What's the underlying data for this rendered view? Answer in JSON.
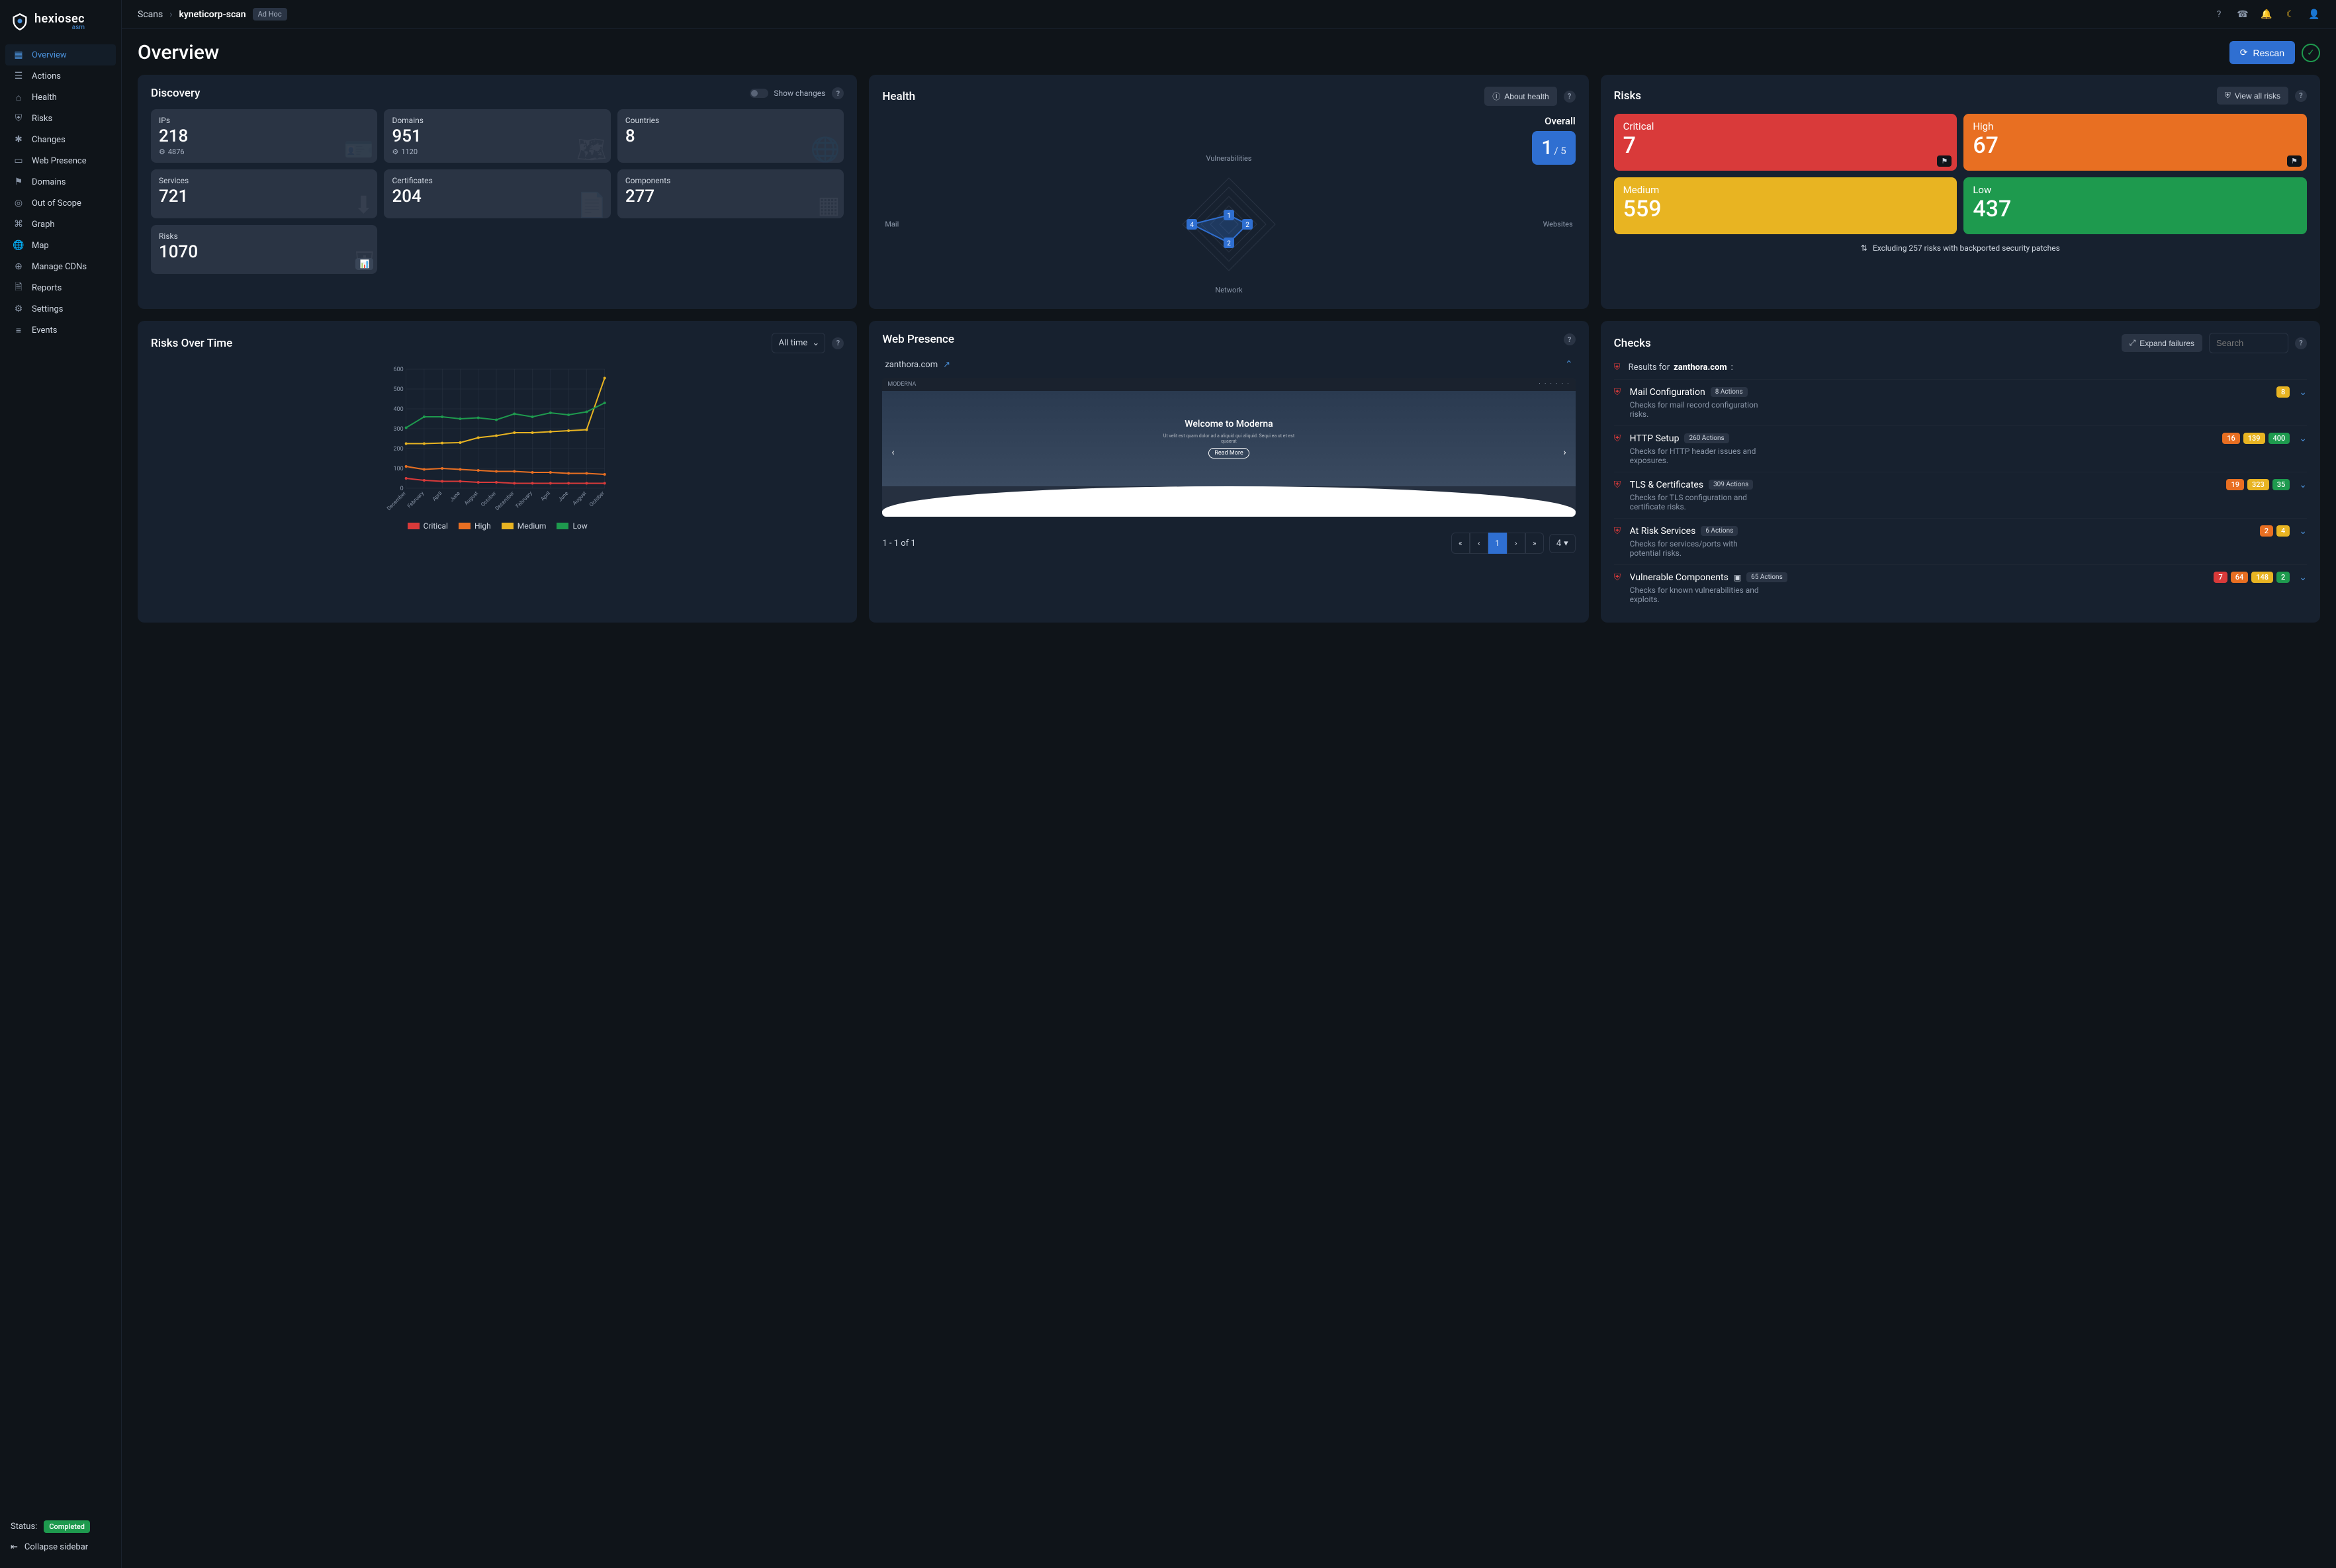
{
  "brand": {
    "name": "hexiosec",
    "sub": "asm"
  },
  "breadcrumb": {
    "root": "Scans",
    "name": "kyneticorp-scan",
    "tag": "Ad Hoc"
  },
  "topbar_icons": [
    "help",
    "support",
    "bell",
    "moon",
    "user"
  ],
  "nav": [
    {
      "icon": "grid",
      "label": "Overview",
      "active": true
    },
    {
      "icon": "list",
      "label": "Actions"
    },
    {
      "icon": "home",
      "label": "Health"
    },
    {
      "icon": "shield",
      "label": "Risks"
    },
    {
      "icon": "star",
      "label": "Changes"
    },
    {
      "icon": "monitor",
      "label": "Web Presence"
    },
    {
      "icon": "sitemap",
      "label": "Domains"
    },
    {
      "icon": "target",
      "label": "Out of Scope"
    },
    {
      "icon": "graph",
      "label": "Graph"
    },
    {
      "icon": "globe",
      "label": "Map"
    },
    {
      "icon": "cdn",
      "label": "Manage CDNs"
    },
    {
      "icon": "file",
      "label": "Reports"
    },
    {
      "icon": "gear",
      "label": "Settings"
    },
    {
      "icon": "lines",
      "label": "Events"
    }
  ],
  "status": {
    "label": "Status:",
    "value": "Completed"
  },
  "collapse": "Collapse sidebar",
  "page_title": "Overview",
  "rescan": "Rescan",
  "discovery": {
    "title": "Discovery",
    "show_changes": "Show changes",
    "tiles": [
      {
        "label": "IPs",
        "value": "218",
        "sub": "4876"
      },
      {
        "label": "Domains",
        "value": "951",
        "sub": "1120"
      },
      {
        "label": "Countries",
        "value": "8"
      },
      {
        "label": "Services",
        "value": "721"
      },
      {
        "label": "Certificates",
        "value": "204"
      },
      {
        "label": "Components",
        "value": "277"
      },
      {
        "label": "Risks",
        "value": "1070"
      }
    ]
  },
  "health": {
    "title": "Health",
    "about": "About health",
    "overall_label": "Overall",
    "overall_score": "1",
    "overall_max": "/ 5",
    "axes": [
      "Vulnerabilities",
      "Websites",
      "Network",
      "Mail"
    ],
    "points": [
      1,
      2,
      2,
      4
    ]
  },
  "risks": {
    "title": "Risks",
    "view_all": "View all risks",
    "tiles": [
      {
        "label": "Critical",
        "value": "7",
        "class": "crit",
        "tag": true
      },
      {
        "label": "High",
        "value": "67",
        "class": "high",
        "tag": true
      },
      {
        "label": "Medium",
        "value": "559",
        "class": "med"
      },
      {
        "label": "Low",
        "value": "437",
        "class": "low"
      }
    ],
    "exclude": "Excluding 257 risks with backported security patches"
  },
  "risks_over_time": {
    "title": "Risks Over Time",
    "range": "All time",
    "legend": [
      "Critical",
      "High",
      "Medium",
      "Low"
    ]
  },
  "chart_data": {
    "type": "line",
    "xlabel": "",
    "ylabel": "",
    "ylim": [
      0,
      600
    ],
    "categories": [
      "December",
      "February",
      "April",
      "June",
      "August",
      "October",
      "December",
      "February",
      "April",
      "June",
      "August",
      "October"
    ],
    "series": [
      {
        "name": "Critical",
        "color": "#d93a3a",
        "values": [
          50,
          40,
          35,
          35,
          30,
          30,
          25,
          25,
          25,
          25,
          25,
          25
        ]
      },
      {
        "name": "High",
        "color": "#e86f22",
        "values": [
          110,
          95,
          100,
          95,
          90,
          85,
          85,
          80,
          80,
          75,
          75,
          70
        ]
      },
      {
        "name": "Medium",
        "color": "#e8b422",
        "values": [
          225,
          225,
          228,
          230,
          255,
          265,
          280,
          280,
          285,
          290,
          295,
          555
        ]
      },
      {
        "name": "Low",
        "color": "#1e9a4e",
        "values": [
          305,
          360,
          360,
          350,
          355,
          345,
          375,
          360,
          380,
          370,
          385,
          430
        ]
      }
    ]
  },
  "web_presence": {
    "title": "Web Presence",
    "domain": "zanthora.com",
    "hero": "Welcome to Moderna",
    "hero_btn": "Read More",
    "brand": "MODERNA",
    "page_range": "1 - 1 of 1",
    "page_num": "1",
    "per_page": "4"
  },
  "checks": {
    "title": "Checks",
    "expand": "Expand failures",
    "search_placeholder": "Search",
    "results_for": "Results for",
    "domain": "zanthora.com",
    "items": [
      {
        "title": "Mail Configuration",
        "actions": "8 Actions",
        "desc": "Checks for mail record configuration risks.",
        "badges": [
          {
            "v": "8",
            "c": "b-med"
          }
        ]
      },
      {
        "title": "HTTP Setup",
        "actions": "260 Actions",
        "desc": "Checks for HTTP header issues and exposures.",
        "badges": [
          {
            "v": "16",
            "c": "b-high"
          },
          {
            "v": "139",
            "c": "b-med"
          },
          {
            "v": "400",
            "c": "b-low"
          }
        ]
      },
      {
        "title": "TLS & Certificates",
        "actions": "309 Actions",
        "desc": "Checks for TLS configuration and certificate risks.",
        "badges": [
          {
            "v": "19",
            "c": "b-high"
          },
          {
            "v": "323",
            "c": "b-med"
          },
          {
            "v": "35",
            "c": "b-low"
          }
        ]
      },
      {
        "title": "At Risk Services",
        "actions": "6 Actions",
        "desc": "Checks for services/ports with potential risks.",
        "badges": [
          {
            "v": "2",
            "c": "b-high"
          },
          {
            "v": "4",
            "c": "b-med"
          }
        ]
      },
      {
        "title": "Vulnerable Components",
        "actions": "65 Actions",
        "extra_icon": true,
        "desc": "Checks for known vulnerabilities and exploits.",
        "badges": [
          {
            "v": "7",
            "c": "b-crit"
          },
          {
            "v": "64",
            "c": "b-high"
          },
          {
            "v": "148",
            "c": "b-med"
          },
          {
            "v": "2",
            "c": "b-low"
          }
        ]
      }
    ]
  }
}
